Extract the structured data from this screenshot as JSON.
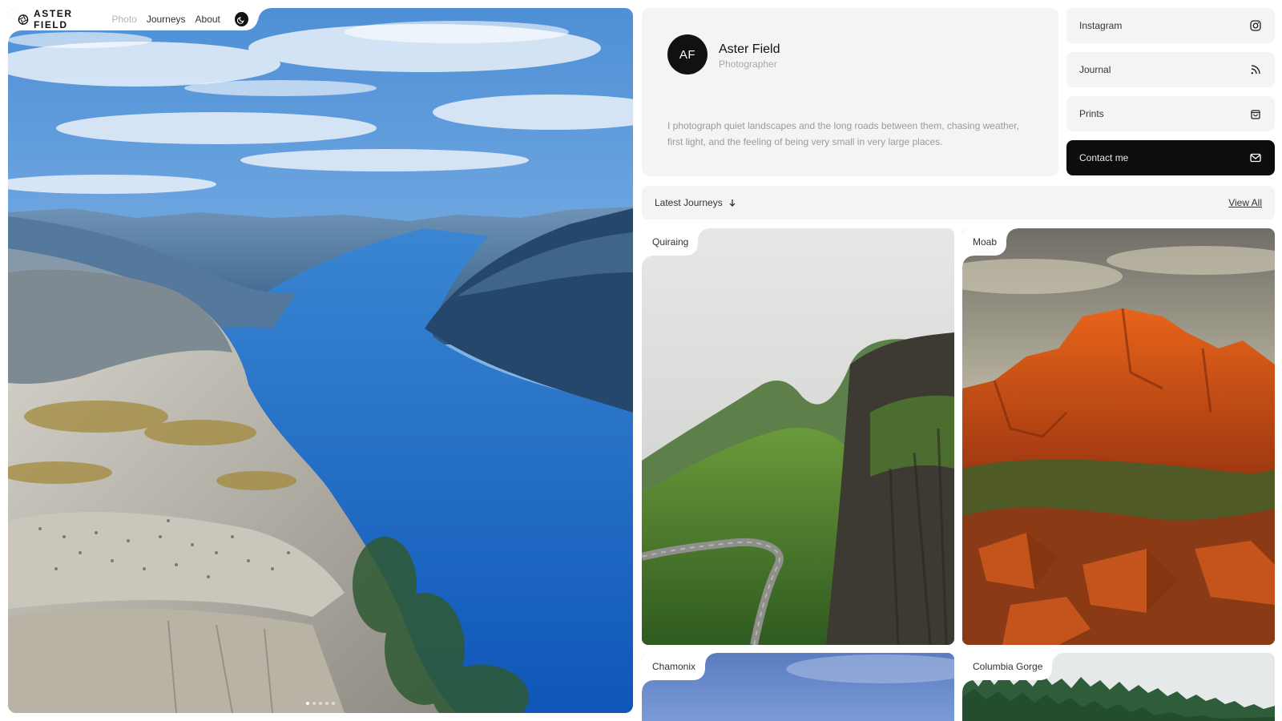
{
  "nav": {
    "brand_name": "ASTER FIELD",
    "brand_sub": "Photo",
    "links": [
      "Journeys",
      "About"
    ],
    "theme_toggle_icon": "moon-icon"
  },
  "hero": {
    "subject": "fjord-cliff-landscape",
    "slides_count": 5,
    "active_slide": 1
  },
  "profile": {
    "initials": "AF",
    "name": "Aster Field",
    "role": "Photographer",
    "bio": "I photograph quiet landscapes and the long roads between them, chasing weather, first light, and the feeling of being very small in very large places."
  },
  "links": [
    {
      "label": "Instagram",
      "icon": "instagram-icon"
    },
    {
      "label": "Journal",
      "icon": "rss-icon"
    },
    {
      "label": "Prints",
      "icon": "shopping-bag-icon"
    },
    {
      "label": "Contact me",
      "icon": "mail-icon",
      "primary": true
    }
  ],
  "journeys": {
    "title": "Latest Journeys",
    "title_icon": "arrow-down-icon",
    "view_all": "View All",
    "items": [
      {
        "label": "Quiraing"
      },
      {
        "label": "Moab"
      },
      {
        "label": "Chamonix"
      },
      {
        "label": "Columbia Gorge"
      }
    ]
  },
  "colors": {
    "panel_bg": "#f4f4f4",
    "dark": "#0d0d0d",
    "muted_text": "#9a9a9a"
  }
}
